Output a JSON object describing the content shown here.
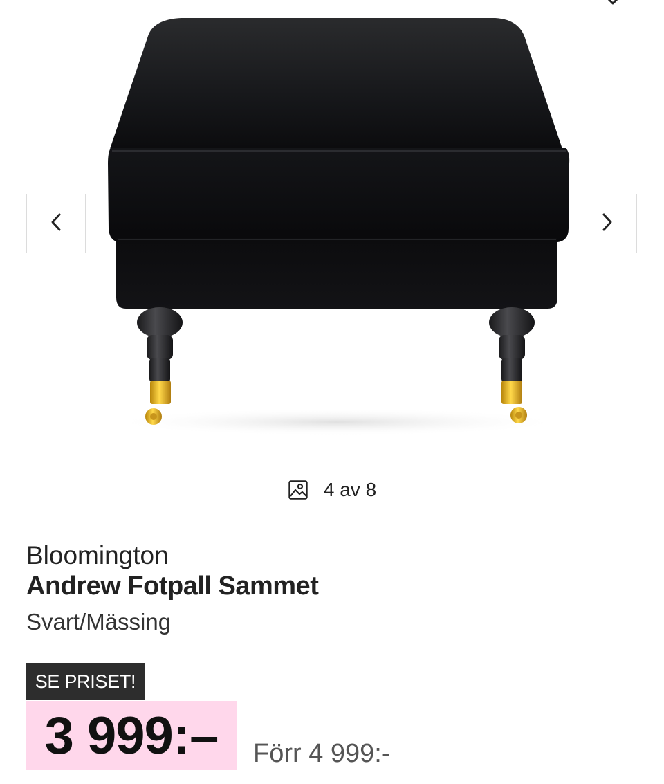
{
  "gallery": {
    "counter_text": "4 av 8",
    "icons": {
      "prev": "chevron-left-icon",
      "next": "chevron-right-icon",
      "counter": "image-icon",
      "top": "chevron-down-icon"
    }
  },
  "product": {
    "brand": "Bloomington",
    "title": "Andrew Fotpall Sammet",
    "variant": "Svart/Mässing"
  },
  "pricing": {
    "badge": "SE PRISET!",
    "price": "3 999:–",
    "old_price": "Förr 4 999:-",
    "colors": {
      "badge_bg": "#2d2d2d",
      "price_bg": "#ffd7eb"
    }
  }
}
